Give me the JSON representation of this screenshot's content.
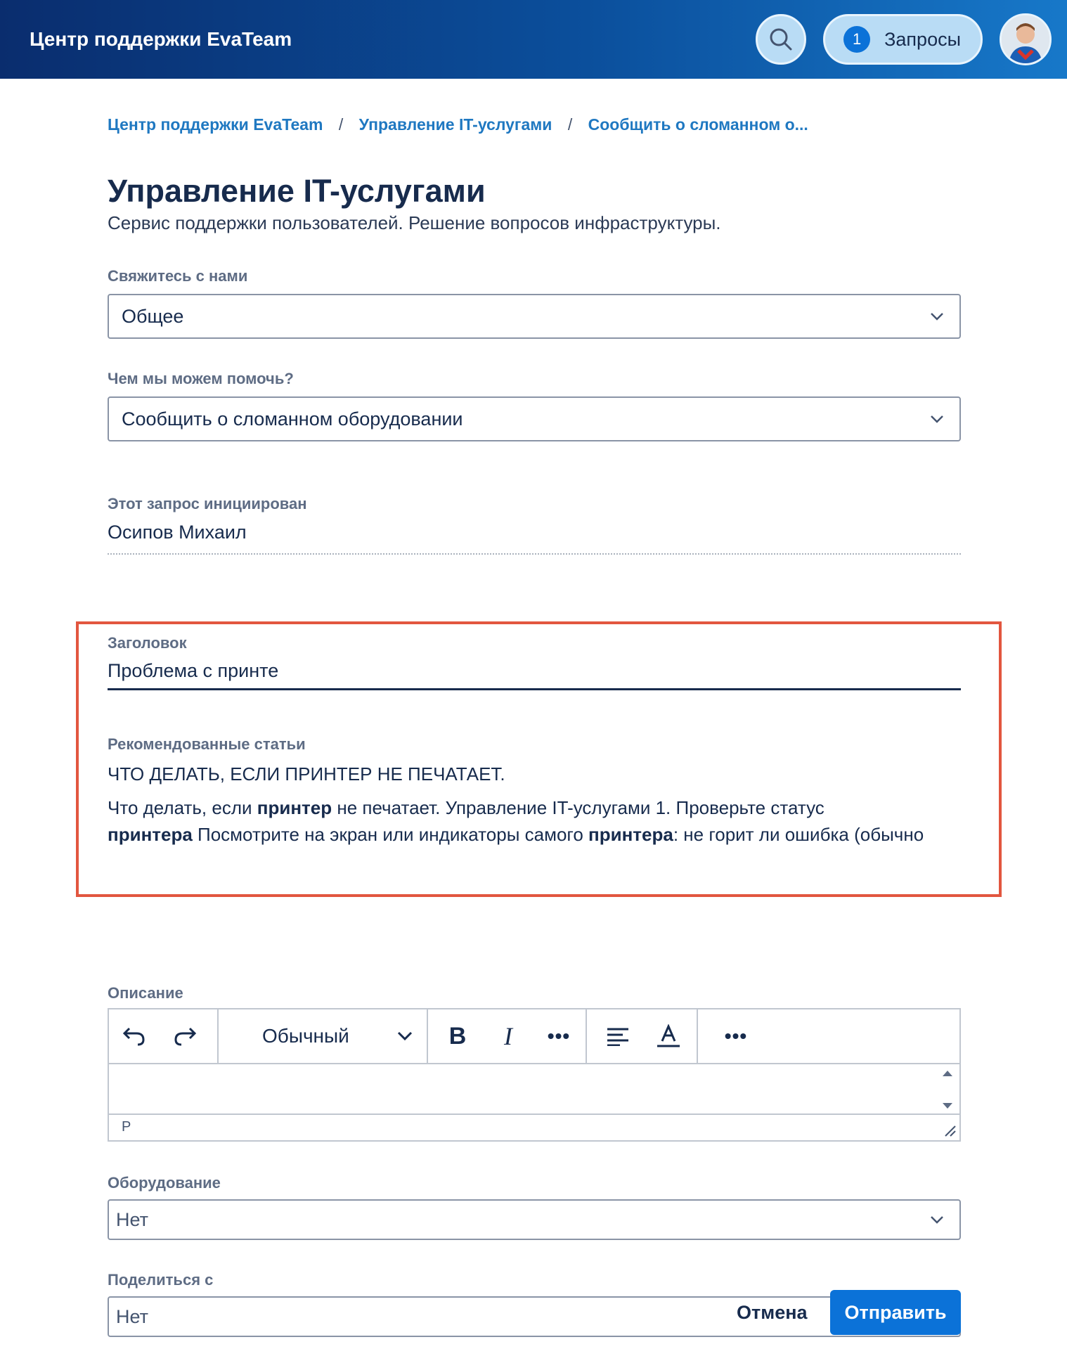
{
  "header": {
    "brand": "Центр поддержки EvaTeam",
    "requests_count": "1",
    "requests_label": "Запросы",
    "search_icon": "search-icon",
    "avatar": "user-avatar"
  },
  "breadcrumb": {
    "items": [
      "Центр поддержки EvaTeam",
      "Управление IT-услугами",
      "Сообщить о сломанном о..."
    ],
    "separator": "/"
  },
  "page": {
    "title": "Управление IT-услугами",
    "subtitle": "Сервис поддержки пользователей. Решение вопросов инфраструктуры."
  },
  "form": {
    "contact": {
      "label": "Свяжитесь с нами",
      "value": "Общее"
    },
    "help": {
      "label": "Чем мы можем помочь?",
      "value": "Сообщить о сломанном оборудовании"
    },
    "initiator": {
      "label": "Этот запрос инициирован",
      "value": "Осипов Михаил"
    },
    "title": {
      "label": "Заголовок",
      "value": "Проблема с принте"
    },
    "recommended": {
      "label": "Рекомендованные статьи",
      "article_title": "ЧТО ДЕЛАТЬ, ЕСЛИ ПРИНТЕР НЕ ПЕЧАТАЕТ.",
      "snippet_parts": [
        "Что делать, если ",
        "принтер",
        " не печатает. Управление IT-услугами 1. Проверьте статус ",
        "принтера",
        " Посмотрите на экран или индикаторы самого ",
        "принтера",
        ": не горит ли ошибка (обычно"
      ]
    },
    "description": {
      "label": "Описание",
      "format_value": "Обычный",
      "status_path": "P"
    },
    "equipment": {
      "label": "Оборудование",
      "value": "Нет"
    },
    "share": {
      "label": "Поделиться с",
      "value": "Нет"
    }
  },
  "actions": {
    "cancel": "Отмена",
    "submit": "Отправить"
  },
  "colors": {
    "header_start": "#0a2d6e",
    "header_end": "#1778c9",
    "link": "#1f78c1",
    "primary": "#0b72d8",
    "highlight": "#e2563f"
  }
}
